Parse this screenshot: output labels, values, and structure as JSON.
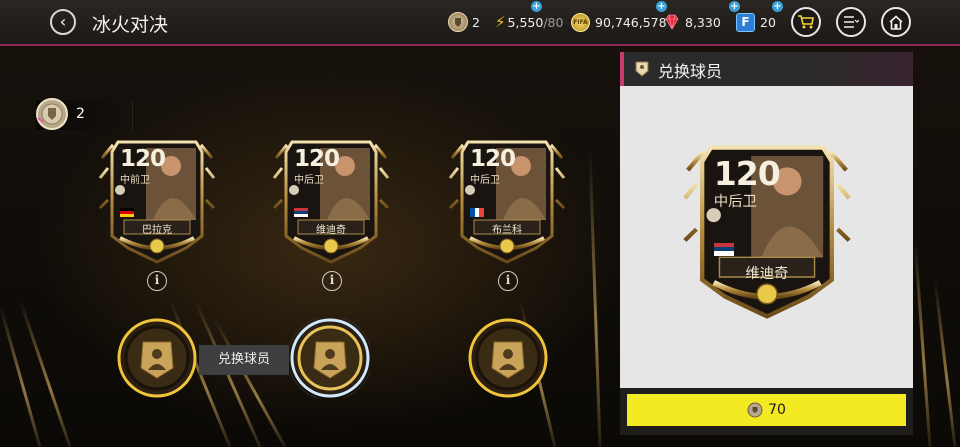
{
  "header": {
    "back_icon": "back-arrow-icon",
    "title": "冰火对决",
    "resources": [
      {
        "id": "tokens",
        "icon": "token-icon",
        "value": "2"
      },
      {
        "id": "stamina",
        "icon": "lightning-icon",
        "value": "5,550",
        "max": "/80"
      },
      {
        "id": "coins",
        "icon": "coin-icon",
        "value": "90,746,578"
      },
      {
        "id": "gems",
        "icon": "gem-icon",
        "value": "8,330"
      },
      {
        "id": "fifa_points",
        "icon": "fifa-points-icon",
        "value": "20"
      }
    ],
    "buttons": [
      "shop-cart-icon",
      "menu-icon",
      "home-icon"
    ]
  },
  "token_count": "2",
  "cards": [
    {
      "rating": "120",
      "position": "中前卫",
      "name": "巴拉克",
      "flag": "germany"
    },
    {
      "rating": "120",
      "position": "中后卫",
      "name": "维迪奇",
      "flag": "serbia"
    },
    {
      "rating": "120",
      "position": "中后卫",
      "name": "布兰科",
      "flag": "france"
    }
  ],
  "info_label": "i",
  "slots": [
    {
      "state": "filled"
    },
    {
      "state": "selected"
    },
    {
      "state": "filled"
    }
  ],
  "tooltip": "兑换球员",
  "panel": {
    "title": "兑换球员",
    "card": {
      "rating": "120",
      "position": "中后卫",
      "name": "维迪奇",
      "flag": "serbia"
    },
    "cost": "70"
  },
  "colors": {
    "accent_pink": "#c93a6c",
    "gold": "#c9a24a",
    "yellow_button": "#f4ea24"
  }
}
